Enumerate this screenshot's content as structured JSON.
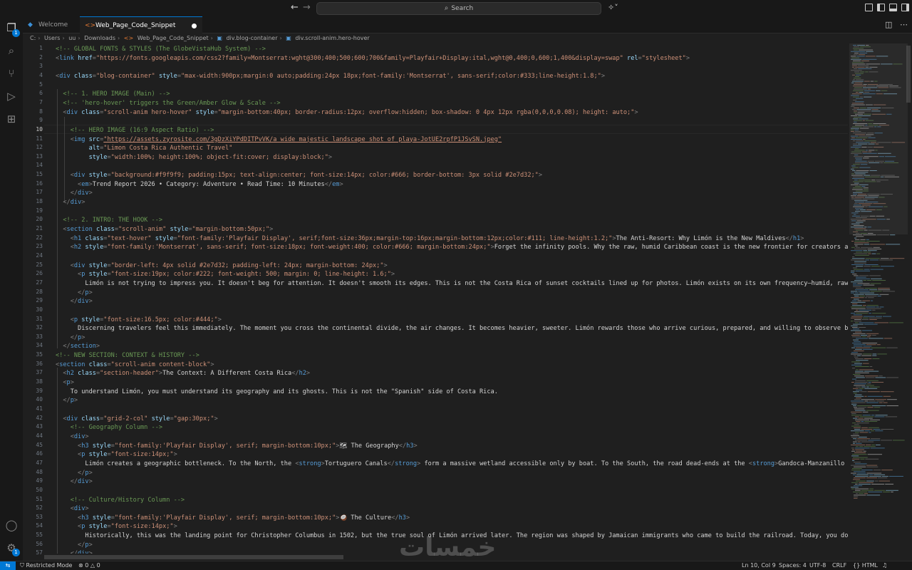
{
  "titlebar": {
    "search_placeholder": "Search",
    "back_icon": "arrow-left-icon",
    "forward_icon": "arrow-right-icon",
    "copilot_icon": "copilot-icon"
  },
  "activity_bar": {
    "explorer_badge": "1",
    "settings_badge": "1",
    "icons": [
      "files-icon",
      "search-icon",
      "source-control-icon",
      "run-debug-icon",
      "extensions-icon",
      "account-icon",
      "settings-gear-icon"
    ]
  },
  "tabs": [
    {
      "label": "Welcome",
      "active": false
    },
    {
      "label": "Web_Page_Code_Snippet",
      "active": true,
      "dirty": true
    }
  ],
  "breadcrumb": [
    "C:",
    "Users",
    "uu",
    "Downloads",
    "Web_Page_Code_Snippet",
    "div.blog-container",
    "div.scroll-anim.hero-hover"
  ],
  "editor": {
    "current_line": 10,
    "lines": [
      [
        [
          "<!-- GLOBAL FONTS & STYLES (The GlobeVistaHub System) -->",
          "c"
        ]
      ],
      [
        [
          "<",
          "p"
        ],
        [
          "link ",
          "t"
        ],
        [
          "href",
          "a"
        ],
        [
          "=",
          "p"
        ],
        [
          "\"https://fonts.googleapis.com/css2?family=Montserrat:wght@300;400;500;600;700&family=Playfair+Display:ital,wght@0,400;0,600;1,400&display=swap\"",
          "s"
        ],
        [
          " ",
          "p"
        ],
        [
          "rel",
          "a"
        ],
        [
          "=",
          "p"
        ],
        [
          "\"stylesheet\"",
          "s"
        ],
        [
          ">",
          "p"
        ]
      ],
      [],
      [
        [
          "<",
          "p"
        ],
        [
          "div ",
          "t"
        ],
        [
          "class",
          "a"
        ],
        [
          "=",
          "p"
        ],
        [
          "\"blog-container\"",
          "s"
        ],
        [
          " ",
          "p"
        ],
        [
          "style",
          "a"
        ],
        [
          "=",
          "p"
        ],
        [
          "\"max-width:900px;margin:0 auto;padding:24px 18px;font-family:'Montserrat', sans-serif;color:",
          "s"
        ],
        [
          "#333",
          "k"
        ],
        [
          ";line-height:1.8;\"",
          "s"
        ],
        [
          ">",
          "p"
        ]
      ],
      [],
      [
        [
          "  <!-- 1. HERO IMAGE (Main) -->",
          "c"
        ]
      ],
      [
        [
          "  <!-- 'hero-hover' triggers the Green/Amber Glow & Scale -->",
          "c"
        ]
      ],
      [
        [
          "  <",
          "p"
        ],
        [
          "div ",
          "t"
        ],
        [
          "class",
          "a"
        ],
        [
          "=",
          "p"
        ],
        [
          "\"scroll-anim hero-hover\"",
          "s"
        ],
        [
          " ",
          "p"
        ],
        [
          "style",
          "a"
        ],
        [
          "=",
          "p"
        ],
        [
          "\"margin-bottom:40px; border-radius:12px; overflow:hidden; box-shadow: 0 4px 12px ",
          "s"
        ],
        [
          "rgba(0,0,0,0.08)",
          "k"
        ],
        [
          "; height: auto;\"",
          "s"
        ],
        [
          ">",
          "p"
        ]
      ],
      [],
      [
        [
          "    <!-- HERO IMAGE (16:9 Aspect Ratio) -->",
          "c"
        ]
      ],
      [
        [
          "    <",
          "p"
        ],
        [
          "img ",
          "t"
        ],
        [
          "src",
          "a"
        ],
        [
          "=",
          "p"
        ],
        [
          "\"https://assets.zyrosite.com/3gDzXiYPdDITPvVK/a_wide_majestic_landscape_shot_of_playa-JotUE2rpfP1JSvSN.jpeg\"",
          "u"
        ]
      ],
      [
        [
          "         ",
          "p"
        ],
        [
          "alt",
          "a"
        ],
        [
          "=",
          "p"
        ],
        [
          "\"Limon Costa Rica Authentic Travel\"",
          "s"
        ]
      ],
      [
        [
          "         ",
          "p"
        ],
        [
          "style",
          "a"
        ],
        [
          "=",
          "p"
        ],
        [
          "\"width:100%; height:100%; object-fit:cover; display:block;\"",
          "s"
        ],
        [
          ">",
          "p"
        ]
      ],
      [],
      [
        [
          "    <",
          "p"
        ],
        [
          "div ",
          "t"
        ],
        [
          "style",
          "a"
        ],
        [
          "=",
          "p"
        ],
        [
          "\"background:",
          "s"
        ],
        [
          "#f9f9f9",
          "k"
        ],
        [
          "; padding:15px; text-align:center; font-size:14px; color:",
          "s"
        ],
        [
          "#666",
          "k"
        ],
        [
          "; border-bottom: 3px solid ",
          "s"
        ],
        [
          "#2e7d32",
          "k"
        ],
        [
          ";\"",
          "s"
        ],
        [
          ">",
          "p"
        ]
      ],
      [
        [
          "      <",
          "p"
        ],
        [
          "em",
          "t"
        ],
        [
          ">",
          "p"
        ],
        [
          "Trend Report 2026 • Category: Adventure • Read Time: 10 Minutes",
          "x"
        ],
        [
          "</",
          "p"
        ],
        [
          "em",
          "t"
        ],
        [
          ">",
          "p"
        ]
      ],
      [
        [
          "    </",
          "p"
        ],
        [
          "div",
          "t"
        ],
        [
          ">",
          "p"
        ]
      ],
      [
        [
          "  </",
          "p"
        ],
        [
          "div",
          "t"
        ],
        [
          ">",
          "p"
        ]
      ],
      [],
      [
        [
          "  <!-- 2. INTRO: THE HOOK -->",
          "c"
        ]
      ],
      [
        [
          "  <",
          "p"
        ],
        [
          "section ",
          "t"
        ],
        [
          "class",
          "a"
        ],
        [
          "=",
          "p"
        ],
        [
          "\"scroll-anim\"",
          "s"
        ],
        [
          " ",
          "p"
        ],
        [
          "style",
          "a"
        ],
        [
          "=",
          "p"
        ],
        [
          "\"margin-bottom:50px;\"",
          "s"
        ],
        [
          ">",
          "p"
        ]
      ],
      [
        [
          "    <",
          "p"
        ],
        [
          "h1 ",
          "t"
        ],
        [
          "class",
          "a"
        ],
        [
          "=",
          "p"
        ],
        [
          "\"text-hover\"",
          "s"
        ],
        [
          " ",
          "p"
        ],
        [
          "style",
          "a"
        ],
        [
          "=",
          "p"
        ],
        [
          "\"font-family:'Playfair Display', serif;font-size:36px;margin-top:16px;margin-bottom:12px;color:",
          "s"
        ],
        [
          "#111",
          "k"
        ],
        [
          "; line-height:1.2;\"",
          "s"
        ],
        [
          ">",
          "p"
        ],
        [
          "The Anti-Resort: Why Limón is the New Maldives",
          "x"
        ],
        [
          "</",
          "p"
        ],
        [
          "h1",
          "t"
        ],
        [
          ">",
          "p"
        ]
      ],
      [
        [
          "    <",
          "p"
        ],
        [
          "h2 ",
          "t"
        ],
        [
          "style",
          "a"
        ],
        [
          "=",
          "p"
        ],
        [
          "\"font-family:'Montserrat', sans-serif; font-size:18px; font-weight:400; color:",
          "s"
        ],
        [
          "#666",
          "k"
        ],
        [
          "; margin-bottom:24px;\"",
          "s"
        ],
        [
          ">",
          "p"
        ],
        [
          "Forget the infinity pools. Why the raw, humid Caribbean coast is the new frontier for creators a",
          "x"
        ]
      ],
      [],
      [
        [
          "    <",
          "p"
        ],
        [
          "div ",
          "t"
        ],
        [
          "style",
          "a"
        ],
        [
          "=",
          "p"
        ],
        [
          "\"border-left: 4px solid ",
          "s"
        ],
        [
          "#2e7d32",
          "k"
        ],
        [
          "; padding-left: 24px; margin-bottom: 24px;\"",
          "s"
        ],
        [
          ">",
          "p"
        ]
      ],
      [
        [
          "      <",
          "p"
        ],
        [
          "p ",
          "t"
        ],
        [
          "style",
          "a"
        ],
        [
          "=",
          "p"
        ],
        [
          "\"font-size:19px; color:",
          "s"
        ],
        [
          "#222",
          "k"
        ],
        [
          "; font-weight: 500; margin: 0; line-height: 1.6;\"",
          "s"
        ],
        [
          ">",
          "p"
        ]
      ],
      [
        [
          "        Limón is not trying to impress you. It doesn't beg for attention. It doesn't smooth its edges. This is not the Costa Rica of sunset cocktails lined up for photos. Limón exists on its own frequency—humid, raw,",
          "x"
        ]
      ],
      [
        [
          "      </",
          "p"
        ],
        [
          "p",
          "t"
        ],
        [
          ">",
          "p"
        ]
      ],
      [
        [
          "    </",
          "p"
        ],
        [
          "div",
          "t"
        ],
        [
          ">",
          "p"
        ]
      ],
      [],
      [
        [
          "    <",
          "p"
        ],
        [
          "p ",
          "t"
        ],
        [
          "style",
          "a"
        ],
        [
          "=",
          "p"
        ],
        [
          "\"font-size:16.5px; color:",
          "s"
        ],
        [
          "#444",
          "k"
        ],
        [
          ";\"",
          "s"
        ],
        [
          ">",
          "p"
        ]
      ],
      [
        [
          "      Discerning travelers feel this immediately. The moment you cross the continental divide, the air changes. It becomes heavier, sweeter. Limón rewards those who arrive curious, prepared, and willing to observe bef",
          "x"
        ]
      ],
      [
        [
          "    </",
          "p"
        ],
        [
          "p",
          "t"
        ],
        [
          ">",
          "p"
        ]
      ],
      [
        [
          "  </",
          "p"
        ],
        [
          "section",
          "t"
        ],
        [
          ">",
          "p"
        ]
      ],
      [
        [
          "<!-- NEW SECTION: CONTEXT & HISTORY -->",
          "c"
        ]
      ],
      [
        [
          "<",
          "p"
        ],
        [
          "section ",
          "t"
        ],
        [
          "class",
          "a"
        ],
        [
          "=",
          "p"
        ],
        [
          "\"scroll-anim content-block\"",
          "s"
        ],
        [
          ">",
          "p"
        ]
      ],
      [
        [
          "  <",
          "p"
        ],
        [
          "h2 ",
          "t"
        ],
        [
          "class",
          "a"
        ],
        [
          "=",
          "p"
        ],
        [
          "\"section-header\"",
          "s"
        ],
        [
          ">",
          "p"
        ],
        [
          "The Context: A Different Costa Rica",
          "x"
        ],
        [
          "</",
          "p"
        ],
        [
          "h2",
          "t"
        ],
        [
          ">",
          "p"
        ]
      ],
      [
        [
          "  <",
          "p"
        ],
        [
          "p",
          "t"
        ],
        [
          ">",
          "p"
        ]
      ],
      [
        [
          "    To understand Limón, you must understand its geography and its ghosts. This is not the \"Spanish\" side of Costa Rica.",
          "x"
        ]
      ],
      [
        [
          "  </",
          "p"
        ],
        [
          "p",
          "t"
        ],
        [
          ">",
          "p"
        ]
      ],
      [],
      [
        [
          "  <",
          "p"
        ],
        [
          "div ",
          "t"
        ],
        [
          "class",
          "a"
        ],
        [
          "=",
          "p"
        ],
        [
          "\"grid-2-col\"",
          "s"
        ],
        [
          " ",
          "p"
        ],
        [
          "style",
          "a"
        ],
        [
          "=",
          "p"
        ],
        [
          "\"gap:30px;\"",
          "s"
        ],
        [
          ">",
          "p"
        ]
      ],
      [
        [
          "    <!-- Geography Column -->",
          "c"
        ]
      ],
      [
        [
          "    <",
          "p"
        ],
        [
          "div",
          "t"
        ],
        [
          ">",
          "p"
        ]
      ],
      [
        [
          "      <",
          "p"
        ],
        [
          "h3 ",
          "t"
        ],
        [
          "style",
          "a"
        ],
        [
          "=",
          "p"
        ],
        [
          "\"font-family:'Playfair Display', serif; margin-bottom:10px;\"",
          "s"
        ],
        [
          ">",
          "p"
        ],
        [
          "🗺 The Geography",
          "x"
        ],
        [
          "</",
          "p"
        ],
        [
          "h3",
          "t"
        ],
        [
          ">",
          "p"
        ]
      ],
      [
        [
          "      <",
          "p"
        ],
        [
          "p ",
          "t"
        ],
        [
          "style",
          "a"
        ],
        [
          "=",
          "p"
        ],
        [
          "\"font-size:14px;\"",
          "s"
        ],
        [
          ">",
          "p"
        ]
      ],
      [
        [
          "        Limón creates a geographic bottleneck. To the North, the ",
          "x"
        ],
        [
          "<",
          "p"
        ],
        [
          "strong",
          "t"
        ],
        [
          ">",
          "p"
        ],
        [
          "Tortuguero Canals",
          "x"
        ],
        [
          "</",
          "p"
        ],
        [
          "strong",
          "t"
        ],
        [
          ">",
          "p"
        ],
        [
          " form a massive wetland accessible only by boat. To the South, the road dead-ends at the ",
          "x"
        ],
        [
          "<",
          "p"
        ],
        [
          "strong",
          "t"
        ],
        [
          ">",
          "p"
        ],
        [
          "Gandoca-Manzanillo Re",
          "x"
        ]
      ],
      [
        [
          "      </",
          "p"
        ],
        [
          "p",
          "t"
        ],
        [
          ">",
          "p"
        ]
      ],
      [
        [
          "    </",
          "p"
        ],
        [
          "div",
          "t"
        ],
        [
          ">",
          "p"
        ]
      ],
      [],
      [
        [
          "    <!-- Culture/History Column -->",
          "c"
        ]
      ],
      [
        [
          "    <",
          "p"
        ],
        [
          "div",
          "t"
        ],
        [
          ">",
          "p"
        ]
      ],
      [
        [
          "      <",
          "p"
        ],
        [
          "h3 ",
          "t"
        ],
        [
          "style",
          "a"
        ],
        [
          "=",
          "p"
        ],
        [
          "\"font-family:'Playfair Display', serif; margin-bottom:10px;\"",
          "s"
        ],
        [
          ">",
          "p"
        ],
        [
          "🥥 The Culture",
          "x"
        ],
        [
          "</",
          "p"
        ],
        [
          "h3",
          "t"
        ],
        [
          ">",
          "p"
        ]
      ],
      [
        [
          "      <",
          "p"
        ],
        [
          "p ",
          "t"
        ],
        [
          "style",
          "a"
        ],
        [
          "=",
          "p"
        ],
        [
          "\"font-size:14px;\"",
          "s"
        ],
        [
          ">",
          "p"
        ]
      ],
      [
        [
          "        Historically, this was the landing point for Christopher Columbus in 1502, but the true soul of Limón arrived later. The region was shaped by Jamaican immigrants who came to build the railroad. Today, you don'",
          "x"
        ]
      ],
      [
        [
          "      </",
          "p"
        ],
        [
          "p",
          "t"
        ],
        [
          ">",
          "p"
        ]
      ],
      [
        [
          "    </",
          "p"
        ],
        [
          "div",
          "t"
        ],
        [
          ">",
          "p"
        ]
      ]
    ]
  },
  "statusbar": {
    "restricted_mode": "Restricted Mode",
    "errors": "0",
    "warnings": "0",
    "position": "Ln 10, Col 9",
    "spaces": "Spaces: 4",
    "encoding": "UTF-8",
    "eol": "CRLF",
    "language": "HTML"
  },
  "watermark": "خمسات",
  "colors": {
    "comment": "#6a9955",
    "tag": "#569cd6",
    "attr": "#9cdcfe",
    "string": "#ce9178",
    "punct": "#808080",
    "text": "#d4d4d4",
    "accent": "#0078d4"
  }
}
